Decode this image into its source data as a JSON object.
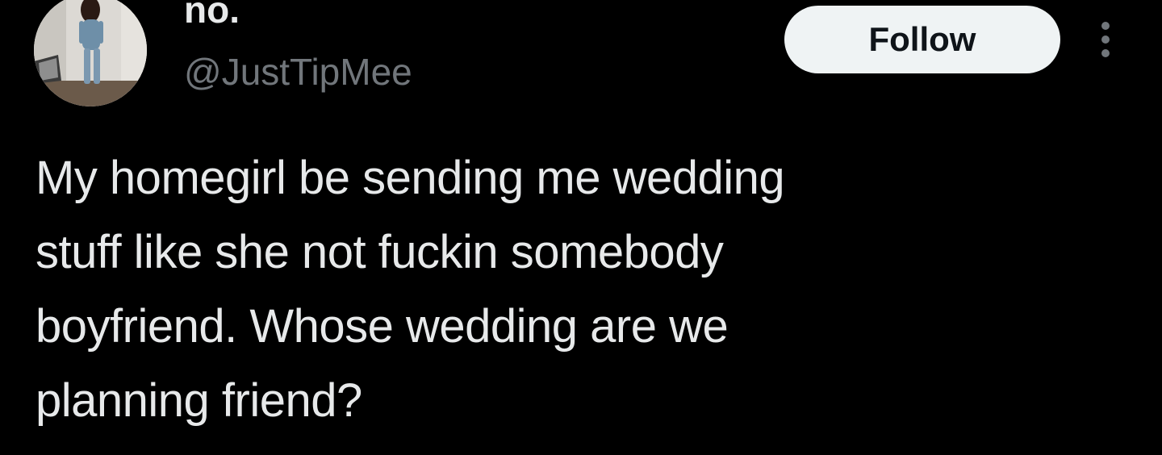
{
  "tweet": {
    "author": {
      "display_name": "no.",
      "handle": "@JustTipMee",
      "avatar_icon": "profile-photo"
    },
    "follow_label": "Follow",
    "more_icon": "more-options-icon",
    "text_lines": [
      "My homegirl be sending me wedding",
      "stuff like she not fuckin somebody",
      "boyfriend. Whose wedding are we",
      "planning friend?"
    ]
  },
  "colors": {
    "background": "#000000",
    "primary_text": "#e7e9ea",
    "secondary_text": "#71767b",
    "follow_bg": "#eff3f4",
    "follow_text": "#0f1419"
  }
}
